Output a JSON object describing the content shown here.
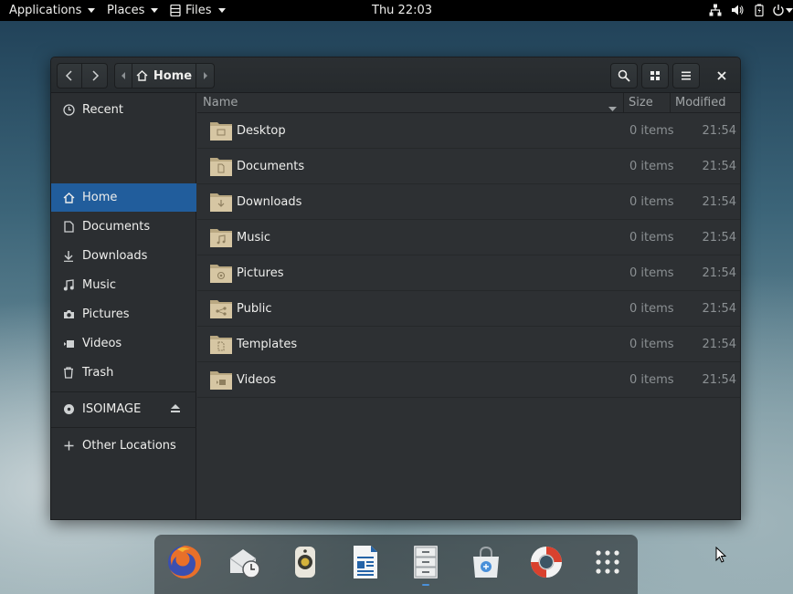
{
  "topbar": {
    "applications": "Applications",
    "places": "Places",
    "files": "Files",
    "clock": "Thu 22:03",
    "tray": [
      "network-icon",
      "volume-icon",
      "battery-icon",
      "power-icon"
    ]
  },
  "window": {
    "path": {
      "current": "Home"
    },
    "buttons": [
      "back",
      "forward",
      "path-left",
      "path-right",
      "search",
      "view-grid",
      "menu",
      "close"
    ]
  },
  "sidebar": {
    "items": [
      {
        "label": "Recent",
        "icon": "clock-icon"
      },
      {
        "label": "Home",
        "icon": "home-icon",
        "active": true
      },
      {
        "label": "Documents",
        "icon": "document-icon"
      },
      {
        "label": "Downloads",
        "icon": "download-icon"
      },
      {
        "label": "Music",
        "icon": "music-icon"
      },
      {
        "label": "Pictures",
        "icon": "camera-icon"
      },
      {
        "label": "Videos",
        "icon": "video-icon"
      },
      {
        "label": "Trash",
        "icon": "trash-icon"
      }
    ],
    "device": {
      "label": "ISOIMAGE",
      "icon": "disc-icon",
      "action": "eject-icon"
    },
    "other": {
      "label": "Other Locations",
      "icon": "plus-icon"
    }
  },
  "list": {
    "columns": {
      "name": "Name",
      "size": "Size",
      "modified": "Modified"
    },
    "rows": [
      {
        "name": "Desktop",
        "size": "0 items",
        "modified": "21:54",
        "icon": "folder-desktop-icon"
      },
      {
        "name": "Documents",
        "size": "0 items",
        "modified": "21:54",
        "icon": "folder-documents-icon"
      },
      {
        "name": "Downloads",
        "size": "0 items",
        "modified": "21:54",
        "icon": "folder-downloads-icon"
      },
      {
        "name": "Music",
        "size": "0 items",
        "modified": "21:54",
        "icon": "folder-music-icon"
      },
      {
        "name": "Pictures",
        "size": "0 items",
        "modified": "21:54",
        "icon": "folder-pictures-icon"
      },
      {
        "name": "Public",
        "size": "0 items",
        "modified": "21:54",
        "icon": "folder-public-icon"
      },
      {
        "name": "Templates",
        "size": "0 items",
        "modified": "21:54",
        "icon": "folder-templates-icon"
      },
      {
        "name": "Videos",
        "size": "0 items",
        "modified": "21:54",
        "icon": "folder-videos-icon"
      }
    ]
  },
  "dock": {
    "apps": [
      "firefox-icon",
      "mail-clock-icon",
      "speaker-icon",
      "writer-document-icon",
      "file-cabinet-icon",
      "software-store-icon",
      "help-lifebuoy-icon",
      "app-grid-icon"
    ],
    "running": "file-cabinet-icon"
  },
  "colors": {
    "accent": "#215d9c",
    "window_bg": "#2d3033",
    "sidebar_bg": "#2b2e31",
    "folder": "#d6c6a3"
  }
}
